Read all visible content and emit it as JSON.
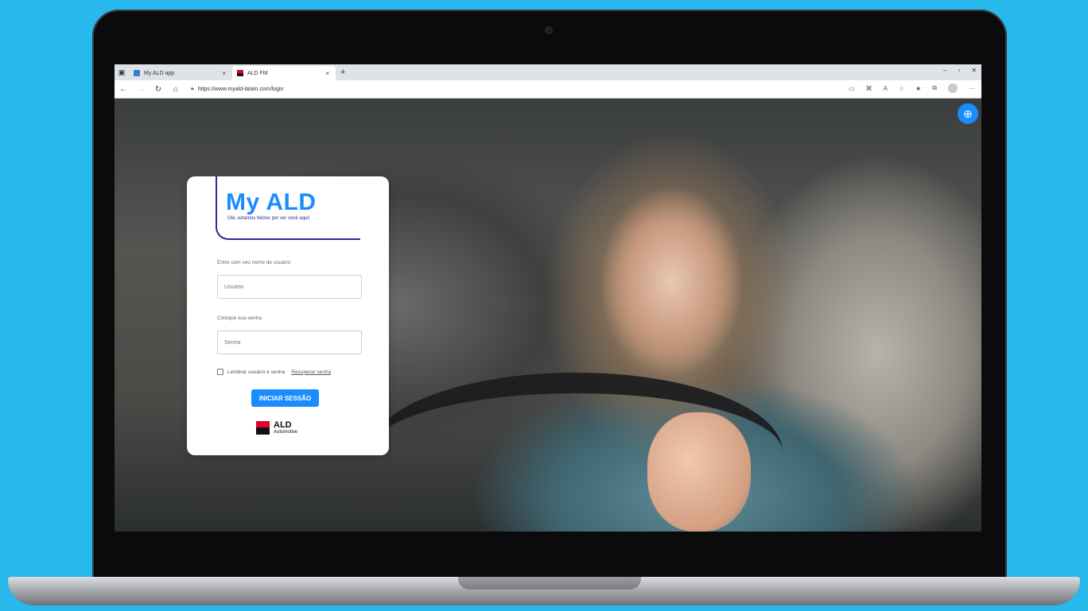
{
  "browser": {
    "tabs": [
      {
        "label": "My ALD app",
        "active": false,
        "close": "×"
      },
      {
        "label": "ALD FM",
        "active": true,
        "close": "×"
      }
    ],
    "new_tab": "+",
    "window_controls": {
      "minimize": "–",
      "restore": "▫",
      "close": "✕"
    },
    "address": "https://www.myald-latam.com/login",
    "menu": "···"
  },
  "page": {
    "brand_title": "My ALD",
    "brand_subtitle": "Olá, estamos felizes por ver você aqui!",
    "username_label": "Entre com seu nome de usuário",
    "username_placeholder": "Usuário",
    "password_label": "Coloque sua senha",
    "password_placeholder": "Senha",
    "remember_label": "Lembrar usuário e senha",
    "recover_link": "Recuperar senha",
    "login_button": "INICIAR SESSÃO",
    "logo_line1": "ALD",
    "logo_line2": "Automotive"
  },
  "colors": {
    "background": "#27b9ec",
    "accent": "#1a8cff",
    "brand_navy": "#2c2c8a",
    "ald_red": "#e4002b"
  },
  "icons": [
    "tab-actions-icon",
    "back-arrow-icon",
    "forward-arrow-icon",
    "reload-icon",
    "home-icon",
    "lock-icon",
    "reader-icon",
    "extensions-icon",
    "read-aloud-icon",
    "favorites-add-icon",
    "favorites-icon",
    "collections-icon",
    "globe-icon"
  ]
}
